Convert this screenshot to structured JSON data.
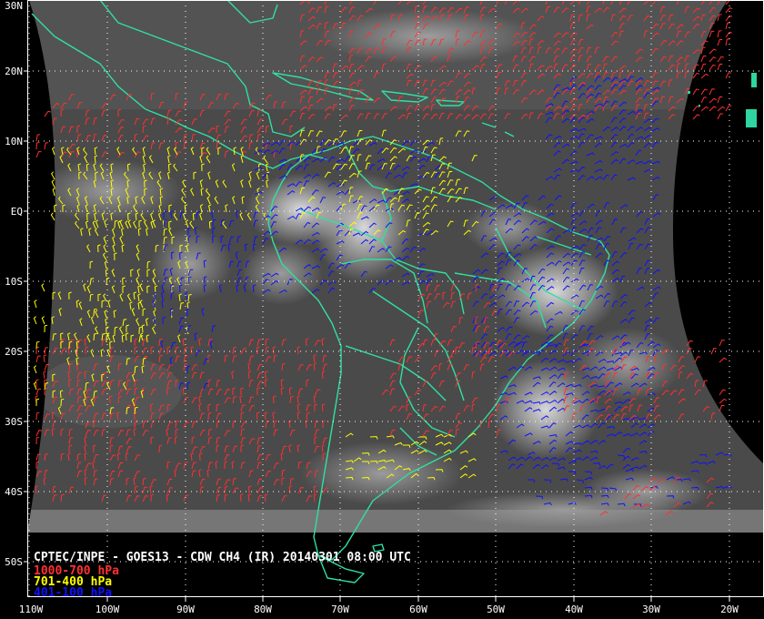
{
  "caption": {
    "title": "CPTEC/INPE - GOES13 - CDW CH4 (IR) 20140301 08:00 UTC",
    "legend": [
      {
        "label": "1000-700 hPa",
        "color": "#ff3030"
      },
      {
        "label": "701-400 hPa",
        "color": "#ffff00"
      },
      {
        "label": "401-100 hPa",
        "color": "#1010ff"
      }
    ]
  },
  "axes": {
    "lat_labels": [
      "30N",
      "20N",
      "10N",
      "EQ",
      "10S",
      "20S",
      "30S",
      "40S",
      "50S"
    ],
    "lon_labels": [
      "110W",
      "100W",
      "90W",
      "80W",
      "70W",
      "60W",
      "50W",
      "40W",
      "30W",
      "20W"
    ]
  },
  "colors": {
    "coastline": "#30e0a0",
    "grid": "#ffffff",
    "background": "#000000"
  }
}
